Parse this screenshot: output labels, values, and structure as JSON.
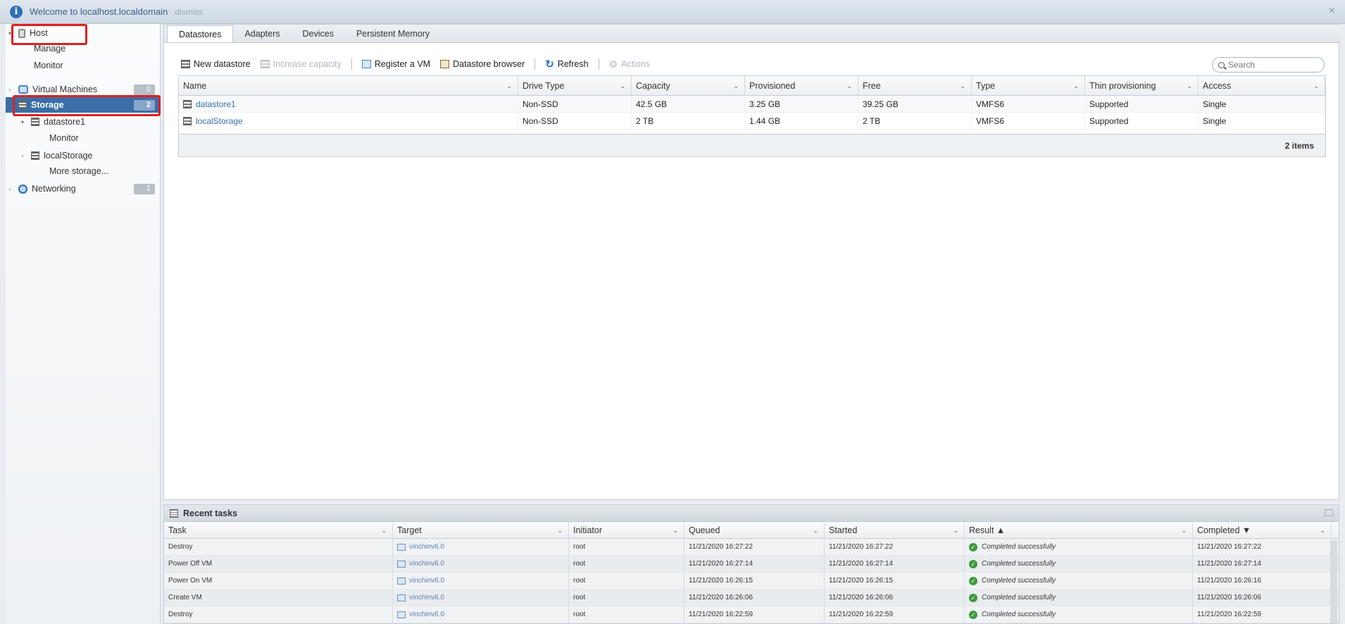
{
  "banner": {
    "text": "Welcome to localhost.localdomain",
    "dismiss": "dismiss",
    "close": "×"
  },
  "sidebar": {
    "host": "Host",
    "manage": "Manage",
    "monitor": "Monitor",
    "vms": {
      "label": "Virtual Machines",
      "count": "0"
    },
    "storage": {
      "label": "Storage",
      "count": "2"
    },
    "datastore1": "datastore1",
    "ds_monitor": "Monitor",
    "local": "localStorage",
    "more": "More storage...",
    "networking": {
      "label": "Networking",
      "count": "1"
    }
  },
  "tabs": [
    "Datastores",
    "Adapters",
    "Devices",
    "Persistent Memory"
  ],
  "toolbar": {
    "new": "New datastore",
    "increase": "Increase capacity",
    "register": "Register a VM",
    "browser": "Datastore browser",
    "refresh": "Refresh",
    "actions": "Actions"
  },
  "search": {
    "placeholder": "Search"
  },
  "grid": {
    "columns": [
      "Name",
      "Drive Type",
      "Capacity",
      "Provisioned",
      "Free",
      "Type",
      "Thin provisioning",
      "Access"
    ],
    "rows": [
      [
        "datastore1",
        "Non-SSD",
        "42.5 GB",
        "3.25 GB",
        "39.25 GB",
        "VMFS6",
        "Supported",
        "Single"
      ],
      [
        "localStorage",
        "Non-SSD",
        "2 TB",
        "1.44 GB",
        "2 TB",
        "VMFS6",
        "Supported",
        "Single"
      ]
    ],
    "footer": "2 items"
  },
  "tasks": {
    "title": "Recent tasks",
    "columns": [
      "Task",
      "Target",
      "Initiator",
      "Queued",
      "Started",
      "Result ▲",
      "Completed ▼"
    ],
    "rows": [
      [
        "Destroy",
        "vinchinv6.0",
        "root",
        "11/21/2020 16:27:22",
        "11/21/2020 16:27:22",
        "Completed successfully",
        "11/21/2020 16:27:22"
      ],
      [
        "Power Off VM",
        "vinchinv6.0",
        "root",
        "11/21/2020 16:27:14",
        "11/21/2020 16:27:14",
        "Completed successfully",
        "11/21/2020 16:27:14"
      ],
      [
        "Power On VM",
        "vinchinv6.0",
        "root",
        "11/21/2020 16:26:15",
        "11/21/2020 16:26:15",
        "Completed successfully",
        "11/21/2020 16:26:16"
      ],
      [
        "Create VM",
        "vinchinv6.0",
        "root",
        "11/21/2020 16:26:06",
        "11/21/2020 16:26:06",
        "Completed successfully",
        "11/21/2020 16:26:06"
      ],
      [
        "Destroy",
        "vinchinv6.0",
        "root",
        "11/21/2020 16:22:59",
        "11/21/2020 16:22:59",
        "Completed successfully",
        "11/21/2020 16:22:59"
      ]
    ]
  }
}
